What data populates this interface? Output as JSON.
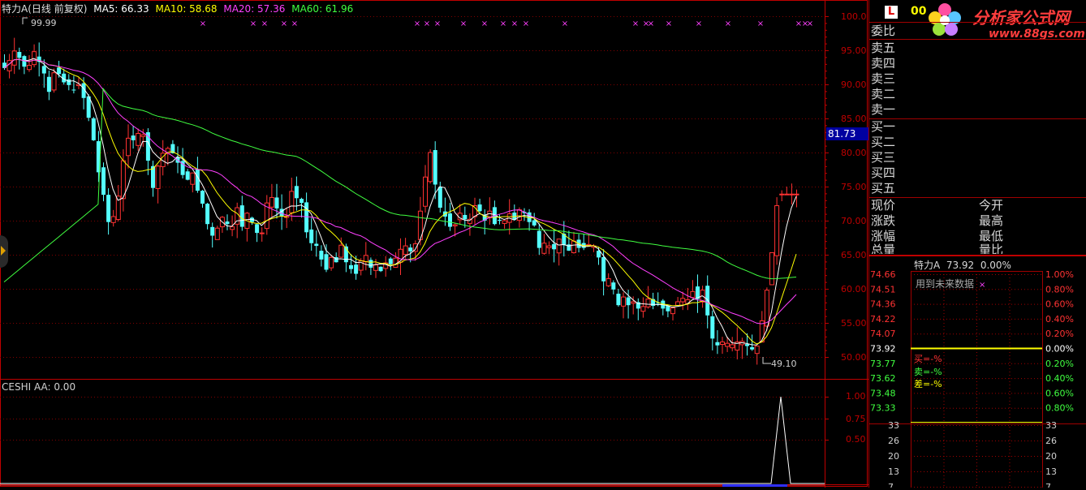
{
  "header": {
    "stock": "特力A",
    "mode": "(日线 前复权)",
    "ma5": "MA5: 66.33",
    "ma10": "MA10: 58.68",
    "ma20": "MA20: 57.36",
    "ma60": "MA60: 61.96",
    "high_label": "99.99",
    "low_label": "49.10",
    "price_tag": "81.73"
  },
  "indicator": {
    "title": "CESHI AA: 0.00",
    "ticks": [
      "1.00",
      "0.75",
      "0.50"
    ]
  },
  "price_axis": [
    "100.0",
    "95.00",
    "90.00",
    "85.00",
    "80.00",
    "75.00",
    "70.00",
    "65.00",
    "60.00",
    "55.00",
    "50.00"
  ],
  "colors": {
    "up": "#ff3232",
    "down": "#54ffff",
    "ma5": "#ffffff",
    "ma10": "#ffff00",
    "ma20": "#ff40ff",
    "ma60": "#40ff40",
    "grid": "#800000",
    "axis": "#c00000"
  },
  "right_panel": {
    "logo_code": "00",
    "watermark_title": "分析家公式网",
    "watermark_url": "www.88gs.com",
    "weibi": "委比",
    "sell": [
      "卖五",
      "卖四",
      "卖三",
      "卖二",
      "卖一"
    ],
    "buy": [
      "买一",
      "买二",
      "买三",
      "买四",
      "买五"
    ],
    "quote_left": [
      "现价",
      "涨跌",
      "涨幅",
      "总量"
    ],
    "quote_right": [
      "今开",
      "最高",
      "最低",
      "量比"
    ],
    "mini_title": "特力A  73.92  0.00%",
    "mini_note": "用到未来数据",
    "mini_left": [
      "74.66",
      "74.51",
      "74.36",
      "74.22",
      "74.07",
      "73.92",
      "73.77",
      "73.62",
      "73.48",
      "73.33"
    ],
    "mini_right": [
      "1.00%",
      "0.80%",
      "0.60%",
      "0.40%",
      "0.20%",
      "0.00%",
      "0.20%",
      "0.40%",
      "0.60%",
      "0.80%"
    ],
    "mini_buy": "买=-%",
    "mini_sell": "卖=-%",
    "mini_diff": "差=-%",
    "vol_left": [
      "33",
      "26",
      "20",
      "13",
      "7"
    ],
    "vol_right": [
      "33",
      "26",
      "20",
      "13",
      "7"
    ]
  },
  "chart_data": {
    "type": "candlestick",
    "x": [
      "1",
      "2",
      "3",
      "4",
      "5",
      "6",
      "7",
      "8",
      "9",
      "10",
      "11",
      "12",
      "13",
      "14",
      "15",
      "16",
      "17",
      "18",
      "19",
      "20",
      "21",
      "22",
      "23",
      "24",
      "25",
      "26",
      "27",
      "28",
      "29",
      "30",
      "31",
      "32",
      "33",
      "34",
      "35",
      "36",
      "37",
      "38",
      "39",
      "40",
      "41",
      "42",
      "43",
      "44",
      "45",
      "46",
      "47",
      "48",
      "49",
      "50",
      "51",
      "52",
      "53",
      "54",
      "55",
      "56",
      "57",
      "58",
      "59",
      "60",
      "61",
      "62",
      "63",
      "64",
      "65",
      "66",
      "67",
      "68",
      "69",
      "70",
      "71",
      "72",
      "73",
      "74",
      "75",
      "76",
      "77",
      "78",
      "79",
      "80",
      "81",
      "82",
      "83",
      "84",
      "85",
      "86",
      "87",
      "88",
      "89",
      "90",
      "91",
      "92",
      "93",
      "94",
      "95",
      "96",
      "97",
      "98",
      "99",
      "100",
      "101",
      "102",
      "103",
      "104",
      "105",
      "106",
      "107",
      "108",
      "109",
      "110",
      "111",
      "112",
      "113",
      "114",
      "115",
      "116",
      "117",
      "118",
      "119",
      "120",
      "121",
      "122",
      "123",
      "124",
      "125",
      "126",
      "127",
      "128",
      "129",
      "130",
      "131",
      "132",
      "133",
      "134",
      "135",
      "136",
      "137",
      "138",
      "139",
      "140",
      "141",
      "142",
      "143",
      "144",
      "145",
      "146",
      "147",
      "148",
      "149",
      "150",
      "151",
      "152",
      "153",
      "154",
      "155",
      "156",
      "157",
      "158",
      "159",
      "160",
      "161"
    ],
    "series": [
      {
        "name": "close",
        "values": [
          92.4,
          93.5,
          94.9,
          93.9,
          92.6,
          92.8,
          94.8,
          93.3,
          91.6,
          88.9,
          91.7,
          91.5,
          90.3,
          89.9,
          89.2,
          90.0,
          88.0,
          85.1,
          81.8,
          77.1,
          73.8,
          69.8,
          70.6,
          73.6,
          78.8,
          82.1,
          81.8,
          82.8,
          82.6,
          78.8,
          74.8,
          78.0,
          79.9,
          80.6,
          79.9,
          78.5,
          76.7,
          76.0,
          77.0,
          74.4,
          72.5,
          69.5,
          67.8,
          68.9,
          70.5,
          69.5,
          69.1,
          71.9,
          69.1,
          71.1,
          69.8,
          68.2,
          68.2,
          72.6,
          73.4,
          71.8,
          70.6,
          70.7,
          74.3,
          73.3,
          72.6,
          68.3,
          66.7,
          66.3,
          64.3,
          62.8,
          64.6,
          63.9,
          66.4,
          63.9,
          62.9,
          62.2,
          64.1,
          64.9,
          63.1,
          63.5,
          62.6,
          63.8,
          63.6,
          64.5,
          65.8,
          66.3,
          65.5,
          66.6,
          71.4,
          76.4,
          80.0,
          75.3,
          71.9,
          70.6,
          69.1,
          69.4,
          71.1,
          70.2,
          70.2,
          72.2,
          71.4,
          70.0,
          71.4,
          69.5,
          70.0,
          70.0,
          71.0,
          70.1,
          71.6,
          71.1,
          69.8,
          69.3,
          66.0,
          66.7,
          66.3,
          65.8,
          67.3,
          66.4,
          65.6,
          67.0,
          66.0,
          66.0,
          66.5,
          66.3,
          64.6,
          61.1,
          61.5,
          59.9,
          57.6,
          58.8,
          57.6,
          58.1,
          57.1,
          57.4,
          58.5,
          57.5,
          57.9,
          57.1,
          56.7,
          57.2,
          58.1,
          58.6,
          58.4,
          59.6,
          58.5,
          59.8,
          56.1,
          52.7,
          51.7,
          52.2,
          52.0,
          51.8,
          52.2,
          52.3,
          51.6,
          51.1,
          51.6,
          55.3,
          59.8,
          65.3,
          72.2,
          73.9,
          73.9,
          73.9,
          73.9
        ]
      }
    ]
  }
}
